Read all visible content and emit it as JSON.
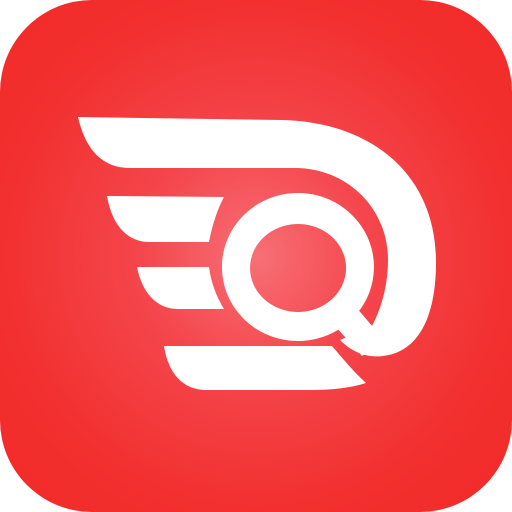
{
  "app_icon": {
    "icon": "winged-q-logo-icon",
    "colors": {
      "background_edge": "#f22a27",
      "background_center": "#f77076",
      "logo": "#ffffff"
    }
  }
}
